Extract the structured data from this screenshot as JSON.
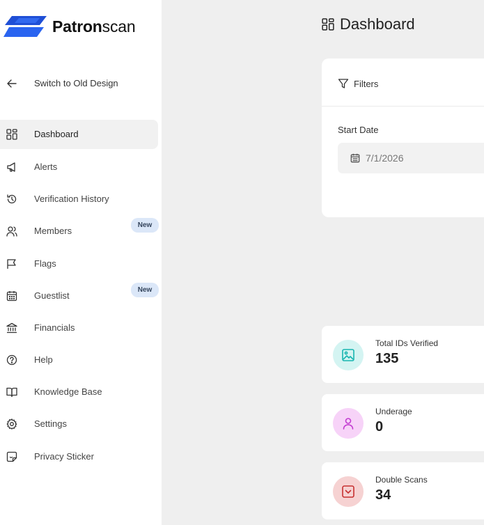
{
  "brand": {
    "name_bold": "Patron",
    "name_light": "scan"
  },
  "sidebar": {
    "back_label": "Switch to Old Design",
    "items": [
      {
        "label": "Dashboard",
        "icon": "dashboard-icon",
        "active": true
      },
      {
        "label": "Alerts",
        "icon": "megaphone-icon"
      },
      {
        "label": "Verification History",
        "icon": "history-icon"
      },
      {
        "label": "Members",
        "icon": "users-icon",
        "badge": "New"
      },
      {
        "label": "Flags",
        "icon": "flag-icon"
      },
      {
        "label": "Guestlist",
        "icon": "calendar-icon",
        "badge": "New"
      },
      {
        "label": "Financials",
        "icon": "bank-icon"
      },
      {
        "label": "Help",
        "icon": "help-icon"
      },
      {
        "label": "Knowledge Base",
        "icon": "book-icon"
      },
      {
        "label": "Settings",
        "icon": "gear-icon"
      },
      {
        "label": "Privacy Sticker",
        "icon": "sticker-icon"
      }
    ]
  },
  "header": {
    "title": "Dashboard"
  },
  "filters": {
    "title": "Filters",
    "start_date_label": "Start Date",
    "start_date_value": "7/1/2026"
  },
  "stats": [
    {
      "label": "Total IDs Verified",
      "value": "135",
      "icon": "image-icon",
      "color": "#17b5b0",
      "bg": "#d4f4f2"
    },
    {
      "label": "Underage",
      "value": "0",
      "icon": "person-icon",
      "color": "#c23ad0",
      "bg": "#f7d3f8"
    },
    {
      "label": "Double Scans",
      "value": "34",
      "icon": "chevron-down-box-icon",
      "color": "#c62f2f",
      "bg": "#f6d2d2"
    }
  ]
}
